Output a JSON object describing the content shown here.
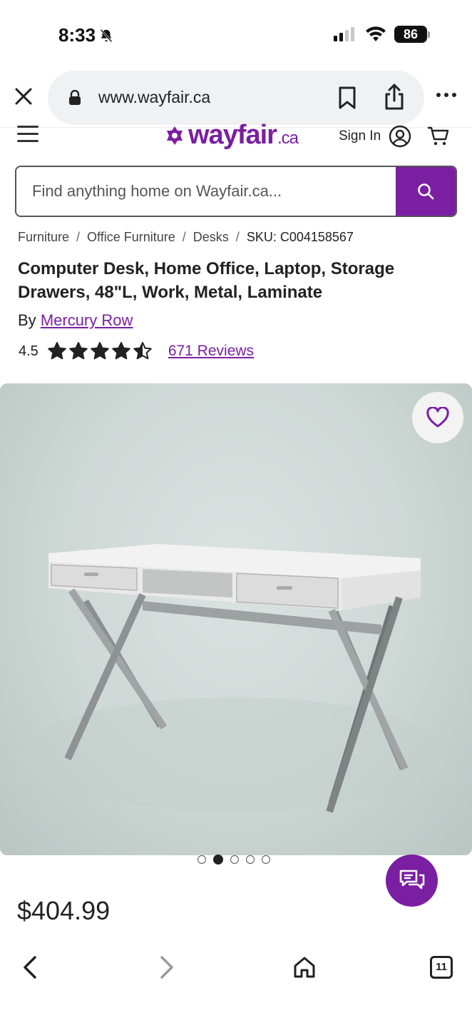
{
  "status_bar": {
    "time": "8:33",
    "battery": "86"
  },
  "browser": {
    "url": "www.wayfair.ca"
  },
  "header": {
    "logo": "wayfair",
    "logo_suffix": ".ca",
    "sign_in": "Sign In"
  },
  "search": {
    "placeholder": "Find anything home on Wayfair.ca..."
  },
  "breadcrumb": {
    "items": [
      "Furniture",
      "Office Furniture",
      "Desks"
    ],
    "separator": "/",
    "sku": "SKU: C004158567"
  },
  "product": {
    "title": "Computer Desk, Home Office, Laptop, Storage Drawers, 48\"L, Work, Metal, Laminate",
    "by_label": "By",
    "brand": "Mercury Row",
    "rating": "4.5",
    "rating_value": 4.5,
    "rating_max": 5,
    "reviews": "671 Reviews",
    "price": "$404.99",
    "image_count": 5,
    "active_image_index": 1
  },
  "bottom_nav": {
    "tab_count": "11"
  },
  "colors": {
    "brand": "#7b1fa2",
    "text": "#222222"
  }
}
